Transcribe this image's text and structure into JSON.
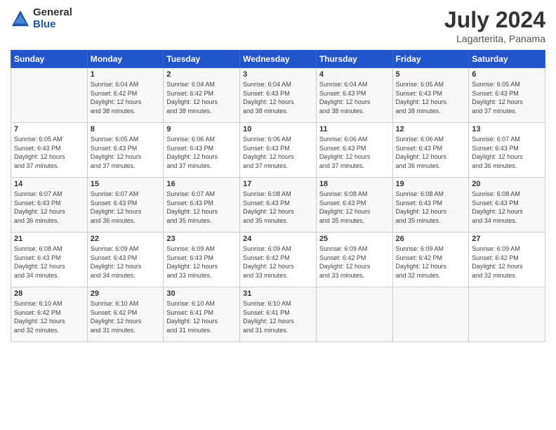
{
  "header": {
    "logo_general": "General",
    "logo_blue": "Blue",
    "month": "July 2024",
    "location": "Lagarterita, Panama"
  },
  "days_of_week": [
    "Sunday",
    "Monday",
    "Tuesday",
    "Wednesday",
    "Thursday",
    "Friday",
    "Saturday"
  ],
  "weeks": [
    [
      {
        "day": "",
        "info": ""
      },
      {
        "day": "1",
        "info": "Sunrise: 6:04 AM\nSunset: 6:42 PM\nDaylight: 12 hours\nand 38 minutes."
      },
      {
        "day": "2",
        "info": "Sunrise: 6:04 AM\nSunset: 6:42 PM\nDaylight: 12 hours\nand 38 minutes."
      },
      {
        "day": "3",
        "info": "Sunrise: 6:04 AM\nSunset: 6:43 PM\nDaylight: 12 hours\nand 38 minutes."
      },
      {
        "day": "4",
        "info": "Sunrise: 6:04 AM\nSunset: 6:43 PM\nDaylight: 12 hours\nand 38 minutes."
      },
      {
        "day": "5",
        "info": "Sunrise: 6:05 AM\nSunset: 6:43 PM\nDaylight: 12 hours\nand 38 minutes."
      },
      {
        "day": "6",
        "info": "Sunrise: 6:05 AM\nSunset: 6:43 PM\nDaylight: 12 hours\nand 37 minutes."
      }
    ],
    [
      {
        "day": "7",
        "info": "Sunrise: 6:05 AM\nSunset: 6:43 PM\nDaylight: 12 hours\nand 37 minutes."
      },
      {
        "day": "8",
        "info": "Sunrise: 6:05 AM\nSunset: 6:43 PM\nDaylight: 12 hours\nand 37 minutes."
      },
      {
        "day": "9",
        "info": "Sunrise: 6:06 AM\nSunset: 6:43 PM\nDaylight: 12 hours\nand 37 minutes."
      },
      {
        "day": "10",
        "info": "Sunrise: 6:06 AM\nSunset: 6:43 PM\nDaylight: 12 hours\nand 37 minutes."
      },
      {
        "day": "11",
        "info": "Sunrise: 6:06 AM\nSunset: 6:43 PM\nDaylight: 12 hours\nand 37 minutes."
      },
      {
        "day": "12",
        "info": "Sunrise: 6:06 AM\nSunset: 6:43 PM\nDaylight: 12 hours\nand 36 minutes."
      },
      {
        "day": "13",
        "info": "Sunrise: 6:07 AM\nSunset: 6:43 PM\nDaylight: 12 hours\nand 36 minutes."
      }
    ],
    [
      {
        "day": "14",
        "info": "Sunrise: 6:07 AM\nSunset: 6:43 PM\nDaylight: 12 hours\nand 36 minutes."
      },
      {
        "day": "15",
        "info": "Sunrise: 6:07 AM\nSunset: 6:43 PM\nDaylight: 12 hours\nand 36 minutes."
      },
      {
        "day": "16",
        "info": "Sunrise: 6:07 AM\nSunset: 6:43 PM\nDaylight: 12 hours\nand 35 minutes."
      },
      {
        "day": "17",
        "info": "Sunrise: 6:08 AM\nSunset: 6:43 PM\nDaylight: 12 hours\nand 35 minutes."
      },
      {
        "day": "18",
        "info": "Sunrise: 6:08 AM\nSunset: 6:43 PM\nDaylight: 12 hours\nand 35 minutes."
      },
      {
        "day": "19",
        "info": "Sunrise: 6:08 AM\nSunset: 6:43 PM\nDaylight: 12 hours\nand 35 minutes."
      },
      {
        "day": "20",
        "info": "Sunrise: 6:08 AM\nSunset: 6:43 PM\nDaylight: 12 hours\nand 34 minutes."
      }
    ],
    [
      {
        "day": "21",
        "info": "Sunrise: 6:08 AM\nSunset: 6:43 PM\nDaylight: 12 hours\nand 34 minutes."
      },
      {
        "day": "22",
        "info": "Sunrise: 6:09 AM\nSunset: 6:43 PM\nDaylight: 12 hours\nand 34 minutes."
      },
      {
        "day": "23",
        "info": "Sunrise: 6:09 AM\nSunset: 6:43 PM\nDaylight: 12 hours\nand 33 minutes."
      },
      {
        "day": "24",
        "info": "Sunrise: 6:09 AM\nSunset: 6:42 PM\nDaylight: 12 hours\nand 33 minutes."
      },
      {
        "day": "25",
        "info": "Sunrise: 6:09 AM\nSunset: 6:42 PM\nDaylight: 12 hours\nand 33 minutes."
      },
      {
        "day": "26",
        "info": "Sunrise: 6:09 AM\nSunset: 6:42 PM\nDaylight: 12 hours\nand 32 minutes."
      },
      {
        "day": "27",
        "info": "Sunrise: 6:09 AM\nSunset: 6:42 PM\nDaylight: 12 hours\nand 32 minutes."
      }
    ],
    [
      {
        "day": "28",
        "info": "Sunrise: 6:10 AM\nSunset: 6:42 PM\nDaylight: 12 hours\nand 32 minutes."
      },
      {
        "day": "29",
        "info": "Sunrise: 6:10 AM\nSunset: 6:42 PM\nDaylight: 12 hours\nand 31 minutes."
      },
      {
        "day": "30",
        "info": "Sunrise: 6:10 AM\nSunset: 6:41 PM\nDaylight: 12 hours\nand 31 minutes."
      },
      {
        "day": "31",
        "info": "Sunrise: 6:10 AM\nSunset: 6:41 PM\nDaylight: 12 hours\nand 31 minutes."
      },
      {
        "day": "",
        "info": ""
      },
      {
        "day": "",
        "info": ""
      },
      {
        "day": "",
        "info": ""
      }
    ]
  ]
}
